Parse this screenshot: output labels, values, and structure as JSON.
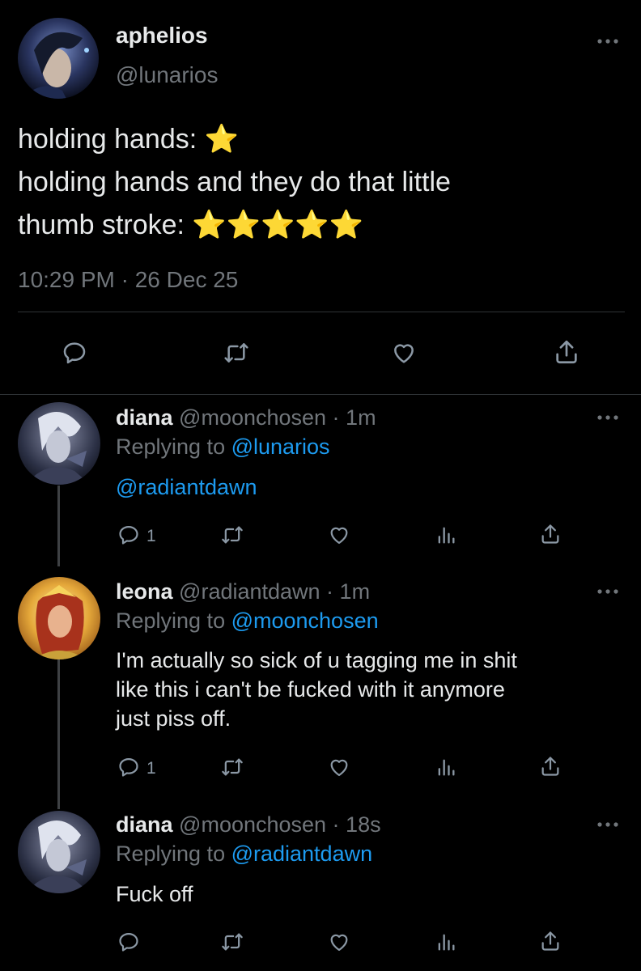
{
  "main_tweet": {
    "display_name": "aphelios",
    "handle": "@lunarios",
    "lines": [
      "holding hands: ⭐",
      "holding hands and they do that little",
      "thumb stroke: ⭐⭐⭐⭐⭐"
    ],
    "timestamp": "10:29 PM · 26 Dec 25"
  },
  "replies": [
    {
      "display_name": "diana",
      "meta": "@moonchosen · 1m",
      "replying_prefix": "Replying to ",
      "replying_to": "@lunarios",
      "text": "@radiantdawn",
      "reply_count": "1"
    },
    {
      "display_name": "leona",
      "meta": "@radiantdawn · 1m",
      "replying_prefix": "Replying to ",
      "replying_to": "@moonchosen",
      "text_lines": [
        "I'm actually so sick of u tagging me in shit",
        "like this i can't be fucked with it anymore",
        "just piss off."
      ],
      "reply_count": "1"
    },
    {
      "display_name": "diana",
      "meta": "@moonchosen · 18s",
      "replying_prefix": "Replying to ",
      "replying_to": "@radiantdawn",
      "text": "Fuck off"
    }
  ],
  "colors": {
    "background": "#000000",
    "text": "#e7e9ea",
    "secondary": "#71767b",
    "accent": "#1d9bf0",
    "divider": "#2f3336"
  },
  "icons": [
    "more-icon",
    "reply-icon",
    "retweet-icon",
    "like-icon",
    "share-icon",
    "analytics-icon"
  ]
}
